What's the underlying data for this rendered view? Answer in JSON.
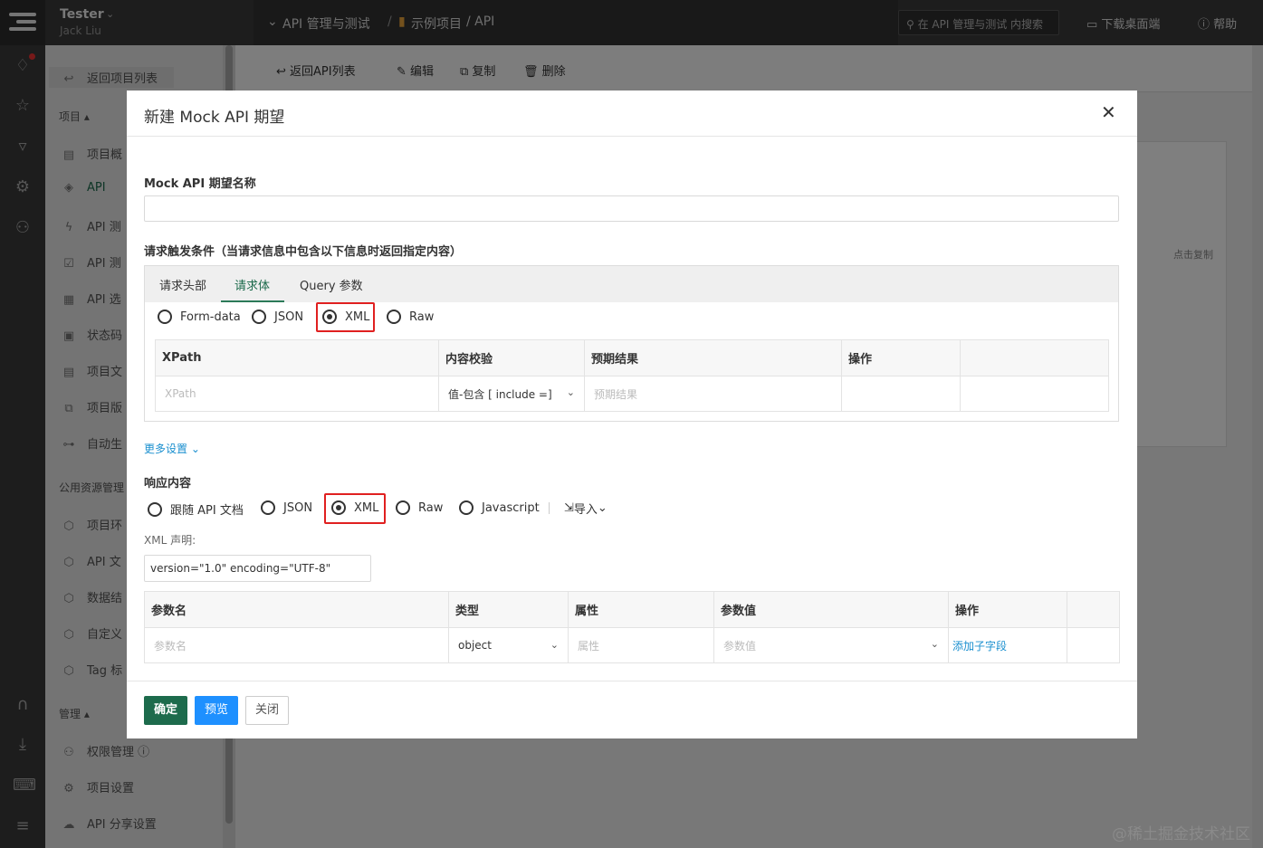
{
  "topbar": {
    "user_name": "Tester",
    "user_sub": "Jack Liu",
    "breadcrumb_1": "API 管理与测试",
    "breadcrumb_sep": "/",
    "breadcrumb_2": "示例项目",
    "breadcrumb_3": "/ API",
    "search_placeholder": "在 API 管理与测试 内搜索",
    "download_label": "下载桌面端",
    "help_label": "帮助"
  },
  "sidebar": {
    "back_label": "返回项目列表",
    "project_section": "项目",
    "items": [
      "项目概",
      "API",
      "API 测",
      "API 测",
      "API 选",
      "状态码",
      "项目文",
      "项目版",
      "自动生"
    ],
    "public_section": "公用资源管理",
    "public_items": [
      "项目环",
      "API 文",
      "数据结",
      "自定义",
      "Tag 标"
    ],
    "manage_section": "管理",
    "manage_items": [
      "权限管理",
      "项目设置",
      "API 分享设置"
    ]
  },
  "toolbar": {
    "back_api_list": "返回API列表",
    "edit": "编辑",
    "copy": "复制",
    "delete": "删除"
  },
  "background": {
    "click_copy": "点击复制"
  },
  "modal": {
    "title": "新建 Mock API 期望",
    "name_label": "Mock API 期望名称",
    "name_value": "",
    "trigger_label": "请求触发条件（当请求信息中包含以下信息时返回指定内容）",
    "tabs": [
      "请求头部",
      "请求体",
      "Query 参数"
    ],
    "request_body_types": [
      "Form-data",
      "JSON",
      "XML",
      "Raw"
    ],
    "request_body_selected": "XML",
    "request_table": {
      "headers": [
        "XPath",
        "内容校验",
        "预期结果",
        "操作",
        ""
      ],
      "row": {
        "xpath_placeholder": "XPath",
        "check": "值-包含 [ include =]",
        "expected_placeholder": "预期结果"
      }
    },
    "more_settings": "更多设置",
    "response_label": "响应内容",
    "response_types": [
      "跟随 API 文档",
      "JSON",
      "XML",
      "Raw",
      "Javascript"
    ],
    "response_selected": "XML",
    "import_label": "导入",
    "xml_decl_label": "XML 声明:",
    "xml_decl_value": "version=\"1.0\" encoding=\"UTF-8\"",
    "response_table": {
      "headers": [
        "参数名",
        "类型",
        "属性",
        "参数值",
        "操作",
        ""
      ],
      "row": {
        "name_placeholder": "参数名",
        "type": "object",
        "attr_placeholder": "属性",
        "value_placeholder": "参数值",
        "action": "添加子字段"
      }
    },
    "buttons": {
      "confirm": "确定",
      "preview": "预览",
      "close": "关闭"
    }
  },
  "watermark": "@稀土掘金技术社区",
  "colors": {
    "primary_green": "#1d6b4c",
    "preview_blue": "#1e90ff",
    "highlight_red": "#e02020"
  }
}
